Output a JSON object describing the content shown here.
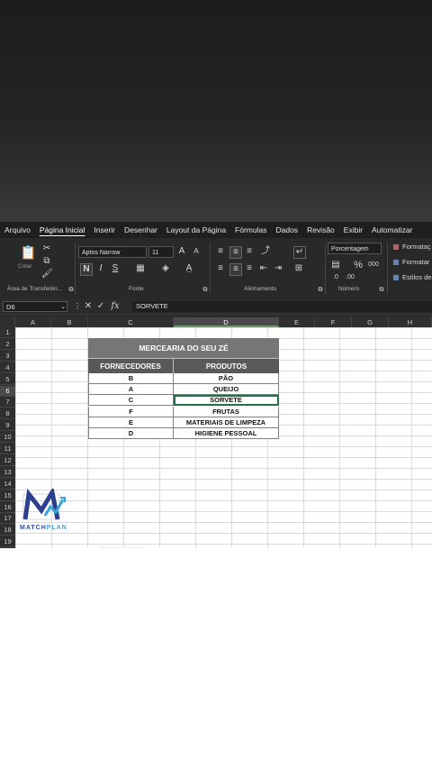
{
  "menu": {
    "tabs": [
      "Arquivo",
      "Página Inicial",
      "Inserir",
      "Desenhar",
      "Layout da Página",
      "Fórmulas",
      "Dados",
      "Revisão",
      "Exibir",
      "Automatizar"
    ]
  },
  "ribbon": {
    "clipboard": {
      "paste_label": "Colar",
      "group_label": "Área de Transferên..."
    },
    "font": {
      "font_name": "Aptos Narrow",
      "font_size": "11",
      "group_label": "Fonte"
    },
    "alignment": {
      "group_label": "Alinhamento"
    },
    "number": {
      "format": "Porcentagem",
      "group_label": "Número"
    },
    "styles": {
      "conditional": "Formataç",
      "format_table": "Formatar",
      "cell_styles": "Estilos de"
    }
  },
  "formula_bar": {
    "cell_ref": "D6",
    "fx": "fx",
    "content": "SORVETE"
  },
  "columns": [
    "A",
    "B",
    "C",
    "D",
    "E",
    "F",
    "G",
    "H"
  ],
  "rows": [
    "1",
    "2",
    "3",
    "4",
    "5",
    "6",
    "7",
    "8",
    "9",
    "10",
    "11",
    "12",
    "13",
    "14",
    "15",
    "16",
    "17",
    "18",
    "19"
  ],
  "sheet": {
    "title": "MERCEARIA DO SEU ZÉ",
    "headers": [
      "FORNECEDORES",
      "PRODUTOS"
    ],
    "data": [
      [
        "B",
        "PÃO"
      ],
      [
        "A",
        "QUEIJO"
      ],
      [
        "C",
        "SORVETE"
      ],
      [
        "F",
        "FRUTAS"
      ],
      [
        "E",
        "MATERIAIS DE LIMPEZA"
      ],
      [
        "D",
        "HIGIENE PESSOAL"
      ]
    ]
  },
  "logo": {
    "brand_a": "MATCH",
    "brand_b": "PLAN"
  }
}
